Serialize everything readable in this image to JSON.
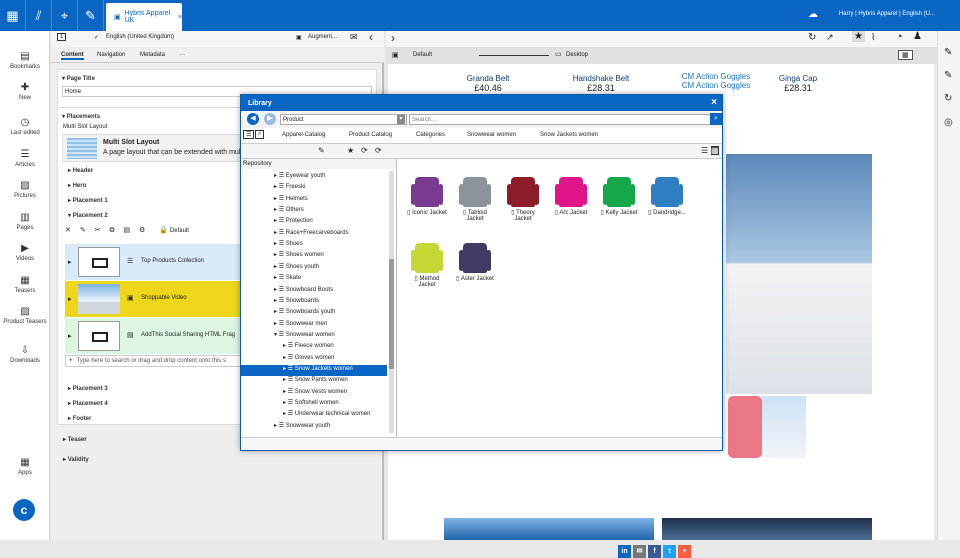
{
  "topbar": {
    "tab_label": "Hybris Apparel UK",
    "tab_close": "×",
    "user_text": "Harry | Hybris Apparel | English (U..."
  },
  "sidebar": {
    "items": [
      {
        "label": "Bookmarks",
        "icon": "bookmark-icon"
      },
      {
        "label": "New",
        "icon": "new-page-icon"
      },
      {
        "label": "Last edited",
        "icon": "history-icon"
      },
      {
        "label": "Articles",
        "icon": "articles-icon"
      },
      {
        "label": "Pictures",
        "icon": "pictures-icon"
      },
      {
        "label": "Pages",
        "icon": "pages-icon"
      },
      {
        "label": "Videos",
        "icon": "videos-icon"
      },
      {
        "label": "Teasers",
        "icon": "teasers-icon"
      },
      {
        "label": "Product Teasers",
        "icon": "product-teasers-icon"
      },
      {
        "label": "Downloads",
        "icon": "downloads-icon"
      }
    ],
    "apps_label": "Apps"
  },
  "editor": {
    "locale": "English (United Kingdom)",
    "augment_label": "Augment...",
    "tabs": [
      "Content",
      "Navigation",
      "Metadata",
      "···"
    ],
    "page_title_head": "Page Title",
    "page_title_value": "Home",
    "placements_head": "Placements",
    "layout_label": "Multi Slot Layout",
    "layout_name": "Multi Slot Layout",
    "layout_desc": "A page layout that can be extended with multip",
    "sections": [
      "Header",
      "Hero",
      "Placement 1",
      "Placement 2"
    ],
    "placement2_default": "Default",
    "items": [
      {
        "label": "Top Products Collection",
        "type_icon": "collection-icon"
      },
      {
        "label": "Shoppable Video",
        "type_icon": "video-icon"
      },
      {
        "label": "AddThis Social Sharing HTML Frag",
        "type_icon": "html-fragment-icon"
      }
    ],
    "drop_hint": "Type here to search or drag and drop content onto this s",
    "more_sections": [
      "Placement 3",
      "Placement 4",
      "Footer"
    ],
    "outer_sections": [
      "Teaser",
      "Validity"
    ]
  },
  "preview": {
    "default_label": "Default",
    "device_label": "Desktop",
    "products": [
      {
        "name": "Granda Belt",
        "price": "£40.46"
      },
      {
        "name": "Handshake Belt",
        "price": "£28.31"
      },
      {
        "name": "CM Action Goggles",
        "price": ""
      },
      {
        "name": "Ginga Cap",
        "price": "£28.31"
      }
    ],
    "sub_product": "CM Action Goggles"
  },
  "library": {
    "title": "Library",
    "type_value": "Product",
    "search_placeholder": "Search...",
    "path": [
      "Apparel-Catalog",
      "Product Catalog",
      "Categories",
      "Snowwear women",
      "Snow Jackets women"
    ],
    "repository_label": "Repository",
    "tree": [
      {
        "label": "Eyewear youth",
        "depth": 1
      },
      {
        "label": "Freeski",
        "depth": 1
      },
      {
        "label": "Helmets",
        "depth": 1
      },
      {
        "label": "Others",
        "depth": 1
      },
      {
        "label": "Protection",
        "depth": 1
      },
      {
        "label": "Race+Freecarveboards",
        "depth": 1
      },
      {
        "label": "Shoes",
        "depth": 1
      },
      {
        "label": "Shoes women",
        "depth": 1
      },
      {
        "label": "Shoes youth",
        "depth": 1
      },
      {
        "label": "Skate",
        "depth": 1
      },
      {
        "label": "Snowboard Boots",
        "depth": 1
      },
      {
        "label": "Snowboards",
        "depth": 1
      },
      {
        "label": "Snowboards youth",
        "depth": 1
      },
      {
        "label": "Snowwear men",
        "depth": 1
      },
      {
        "label": "Snowwear women",
        "depth": 1
      },
      {
        "label": "Fleece women",
        "depth": 2
      },
      {
        "label": "Gloves women",
        "depth": 2
      },
      {
        "label": "Snow Jackets women",
        "depth": 2,
        "selected": true
      },
      {
        "label": "Snow Pants women",
        "depth": 2
      },
      {
        "label": "Snow Vests women",
        "depth": 2
      },
      {
        "label": "Softshell women",
        "depth": 2
      },
      {
        "label": "Underwear technical women",
        "depth": 2
      },
      {
        "label": "Snowwear youth",
        "depth": 1
      }
    ],
    "products": [
      {
        "name": "Iconic Jacket",
        "color": "#7a3a8f"
      },
      {
        "name": "Tabloid Jacket",
        "color": "#8d939a"
      },
      {
        "name": "Theory Jacket",
        "color": "#8c1c2a"
      },
      {
        "name": "Arc Jacket",
        "color": "#e0158a"
      },
      {
        "name": "Kelly Jacket",
        "color": "#15a84a"
      },
      {
        "name": "Dandridge...",
        "color": "#2f80c2"
      },
      {
        "name": "Method Jacket",
        "color": "#c6d836"
      },
      {
        "name": "Aster Jacket",
        "color": "#3f3b63"
      }
    ]
  }
}
